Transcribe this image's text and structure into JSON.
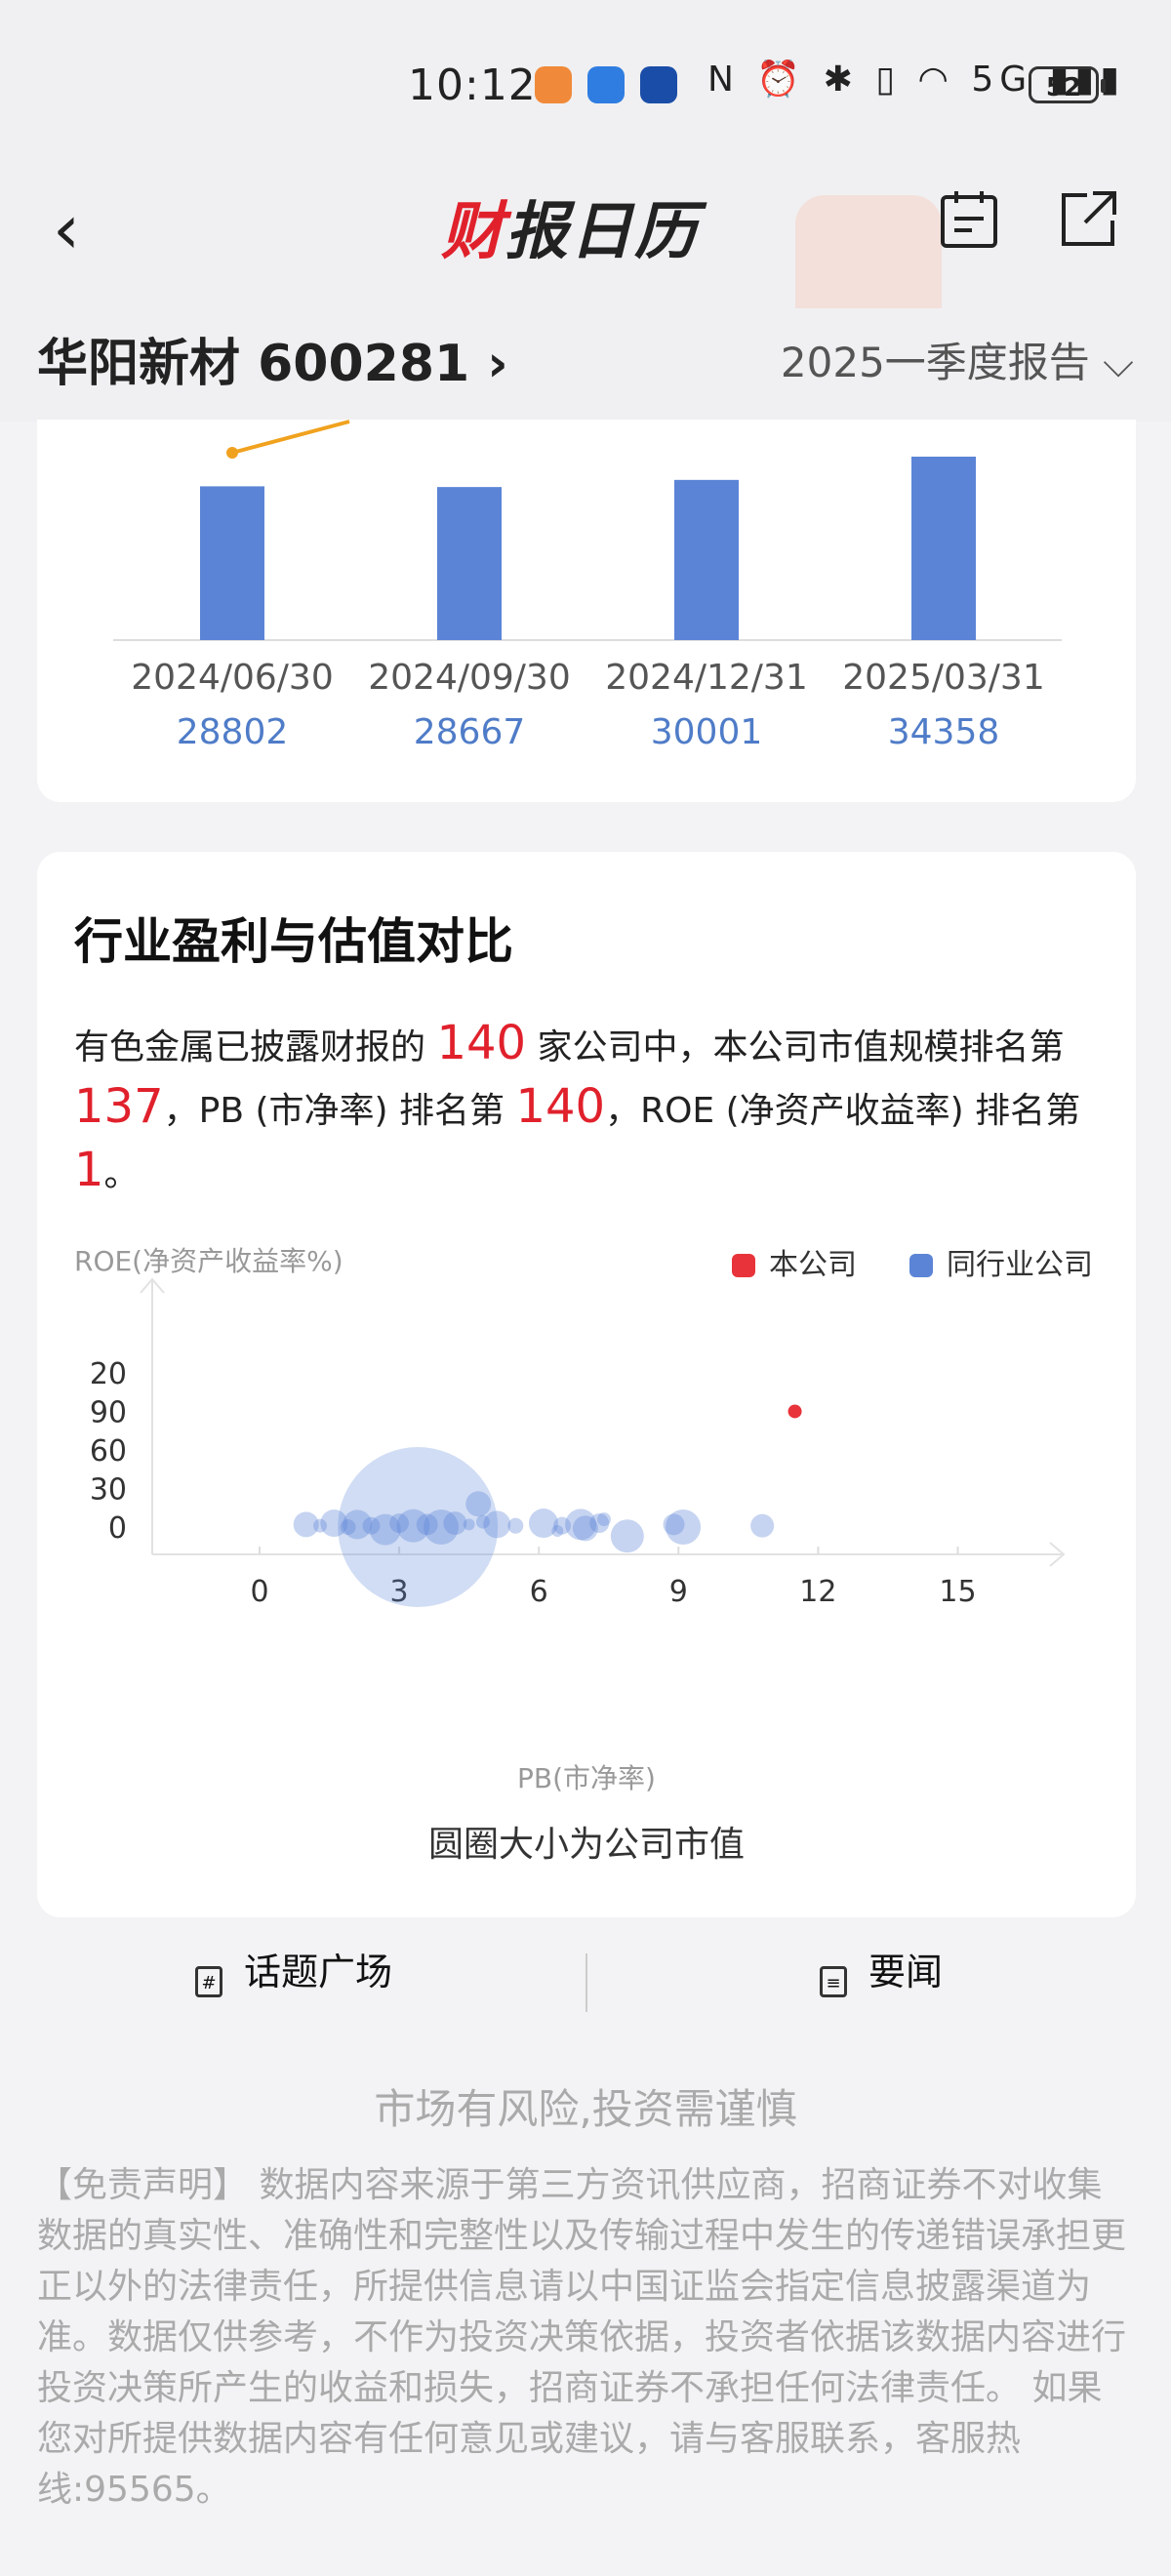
{
  "status_bar": {
    "time": "10:12",
    "battery": "52",
    "icons_text": "N ⏰ ✱ ▯ ◠ 5G ▮▮▮"
  },
  "header": {
    "logo_prefix": "财",
    "logo_rest": "报日历"
  },
  "stock": {
    "name": "华阳新材 600281 ›",
    "period": "2025一季度报告 ⌵"
  },
  "top_chart": {
    "items": [
      {
        "date": "2024/06/30",
        "value": "28802"
      },
      {
        "date": "2024/09/30",
        "value": "28667"
      },
      {
        "date": "2024/12/31",
        "value": "30001"
      },
      {
        "date": "2025/03/31",
        "value": "34358"
      }
    ],
    "bar_values": [
      28802,
      28667,
      30001,
      34358
    ]
  },
  "compare": {
    "title": "行业盈利与估值对比",
    "desc_1": "有色金属已披露财报的 ",
    "total": "140",
    "desc_2": " 家公司中，本公司市值规模排名第 ",
    "rank_mv": "137",
    "desc_3": "，PB (市净率) 排名第 ",
    "rank_pb": "140",
    "desc_4": "，ROE (净资产收益率) 排名第 ",
    "rank_roe": "1",
    "desc_5": "。"
  },
  "chart_data": {
    "type": "scatter",
    "ylabel": "ROE(净资产收益率%)",
    "xlabel": "PB(市净率)",
    "x_ticks": [
      "0",
      "3",
      "6",
      "9",
      "12",
      "15"
    ],
    "y_ticks": [
      "0",
      "30",
      "60",
      "90",
      "20"
    ],
    "legend": [
      "本公司",
      "同行业公司"
    ],
    "note": "圆圈大小为公司市值",
    "colors": {
      "self": "#e8333a",
      "peer": "#5b84d6"
    },
    "self_point": {
      "x": 11.5,
      "y": 90
    },
    "peer_points": [
      {
        "x": 3.4,
        "y": 0,
        "size": "large"
      },
      {
        "x": 1.0,
        "y": 2
      },
      {
        "x": 1.3,
        "y": 1
      },
      {
        "x": 1.6,
        "y": 3
      },
      {
        "x": 1.9,
        "y": 0
      },
      {
        "x": 2.1,
        "y": 2
      },
      {
        "x": 2.4,
        "y": 1
      },
      {
        "x": 2.7,
        "y": -2
      },
      {
        "x": 3.0,
        "y": 3
      },
      {
        "x": 3.3,
        "y": 1
      },
      {
        "x": 3.6,
        "y": 2
      },
      {
        "x": 3.9,
        "y": 0
      },
      {
        "x": 4.2,
        "y": 3
      },
      {
        "x": 4.5,
        "y": 2
      },
      {
        "x": 4.7,
        "y": 18
      },
      {
        "x": 4.8,
        "y": 4
      },
      {
        "x": 5.1,
        "y": 2
      },
      {
        "x": 5.5,
        "y": 1
      },
      {
        "x": 6.1,
        "y": 3
      },
      {
        "x": 6.5,
        "y": 1
      },
      {
        "x": 6.9,
        "y": 2
      },
      {
        "x": 7.3,
        "y": 3
      },
      {
        "x": 7.9,
        "y": -7
      },
      {
        "x": 8.9,
        "y": 2
      },
      {
        "x": 9.1,
        "y": 0
      },
      {
        "x": 10.8,
        "y": 1
      },
      {
        "x": 6.4,
        "y": -3
      },
      {
        "x": 7.0,
        "y": -1
      },
      {
        "x": 7.4,
        "y": 6
      }
    ]
  },
  "tabs": {
    "topic": "话题广场",
    "news": "要闻"
  },
  "footer": {
    "risk": "市场有风险,投资需谨慎",
    "disclaimer": "【免责声明】 数据内容来源于第三方资讯供应商，招商证券不对收集数据的真实性、准确性和完整性以及传输过程中发生的传递错误承担更正以外的法律责任，所提供信息请以中国证监会指定信息披露渠道为准。数据仅供参考，不作为投资决策依据，投资者依据该数据内容进行投资决策所产生的收益和损失，招商证券不承担任何法律责任。 如果您对所提供数据内容有任何意见或建议，请与客服联系，客服热线:95565。"
  }
}
